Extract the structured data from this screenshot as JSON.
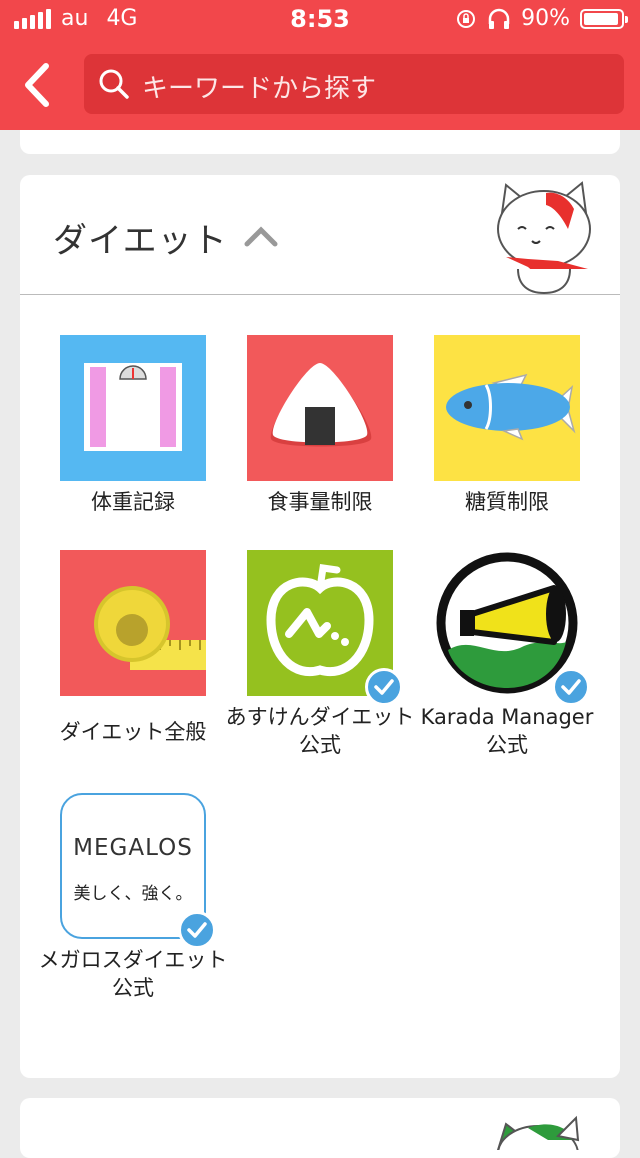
{
  "status_bar": {
    "carrier": "au",
    "network": "4G",
    "time": "8:53",
    "battery": "90%"
  },
  "search": {
    "placeholder": "キーワードから探す"
  },
  "section": {
    "title": "ダイエット",
    "items": [
      {
        "label": "体重記録",
        "verified": false
      },
      {
        "label": "食事量制限",
        "verified": false
      },
      {
        "label": "糖質制限",
        "verified": false
      },
      {
        "label": "ダイエット全般",
        "verified": false
      },
      {
        "label": "あすけんダイエット公式",
        "verified": true
      },
      {
        "label": "Karada Manager 公式",
        "verified": true
      },
      {
        "label": "メガロスダイエット公式",
        "verified": true
      }
    ],
    "megalos_logo": {
      "brand": "MEGALOS",
      "tagline": "美しく、強く。"
    }
  },
  "colors": {
    "header": "#f2474b",
    "search_bg": "#dd3438",
    "badge": "#4aa3df"
  }
}
